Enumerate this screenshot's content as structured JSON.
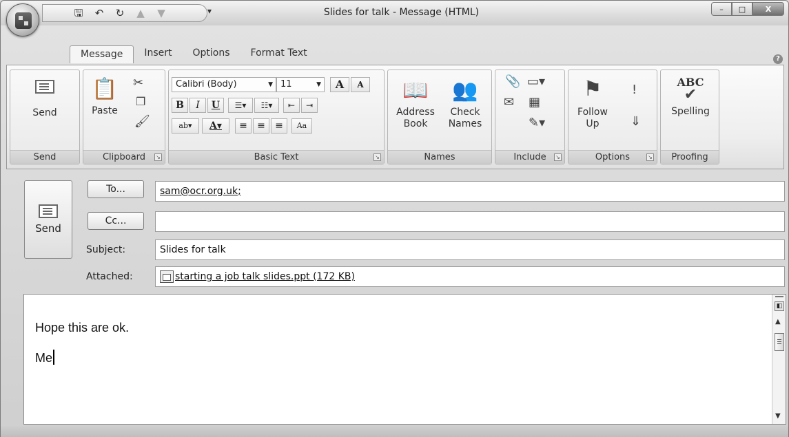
{
  "window": {
    "title": "Slides for talk - Message (HTML)",
    "controls": {
      "minimize": "–",
      "maximize": "□",
      "close": "X"
    }
  },
  "qat": {
    "dropdown": "▾"
  },
  "tabs": [
    {
      "label": "Message",
      "active": true
    },
    {
      "label": "Insert"
    },
    {
      "label": "Options"
    },
    {
      "label": "Format Text"
    }
  ],
  "help": "?",
  "ribbon": {
    "send_group": {
      "button": "Send",
      "label": "Send"
    },
    "clipboard": {
      "paste": "Paste",
      "label": "Clipboard"
    },
    "basic_text": {
      "font": "Calibri (Body)",
      "size": "11",
      "grow": "A",
      "shrink": "A",
      "bold": "B",
      "italic": "I",
      "underline": "U",
      "highlight": "ab",
      "font_color": "A",
      "label": "Basic Text"
    },
    "names": {
      "address_book": "Address Book",
      "check_names": "Check Names",
      "label": "Names"
    },
    "include": {
      "label": "Include"
    },
    "options": {
      "follow_up": "Follow Up",
      "label": "Options"
    },
    "proofing": {
      "spelling": "Spelling",
      "abc": "ABC",
      "label": "Proofing"
    }
  },
  "header": {
    "send": "Send",
    "to_button": "To...",
    "to_value": "sam@ocr.org.uk;",
    "cc_button": "Cc...",
    "cc_value": "",
    "subject_label": "Subject:",
    "subject_value": "Slides for talk",
    "attached_label": "Attached:",
    "attached_value": "starting a job talk slides.ppt (172 KB)"
  },
  "body": {
    "line1": "Hope this are ok.",
    "line2": "Me"
  }
}
